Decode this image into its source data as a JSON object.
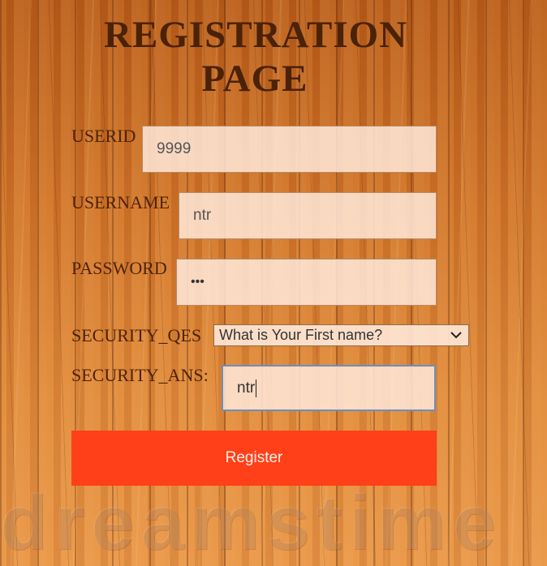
{
  "page": {
    "title": "REGISTRATION PAGE",
    "watermark": "dreamstime"
  },
  "form": {
    "userid": {
      "label": "USERID",
      "value": "9999"
    },
    "username": {
      "label": "USERNAME",
      "value": "ntr"
    },
    "password": {
      "label": "PASSWORD",
      "value": "•••"
    },
    "security_question": {
      "label": "SECURITY_QES",
      "selected": "What is Your First name?"
    },
    "security_answer": {
      "label": "SECURITY_ANS:",
      "value": "ntr"
    },
    "submit_label": "Register"
  },
  "colors": {
    "title": "#4a2208",
    "button": "#ff4019",
    "focus_border": "#6d8fbf"
  }
}
